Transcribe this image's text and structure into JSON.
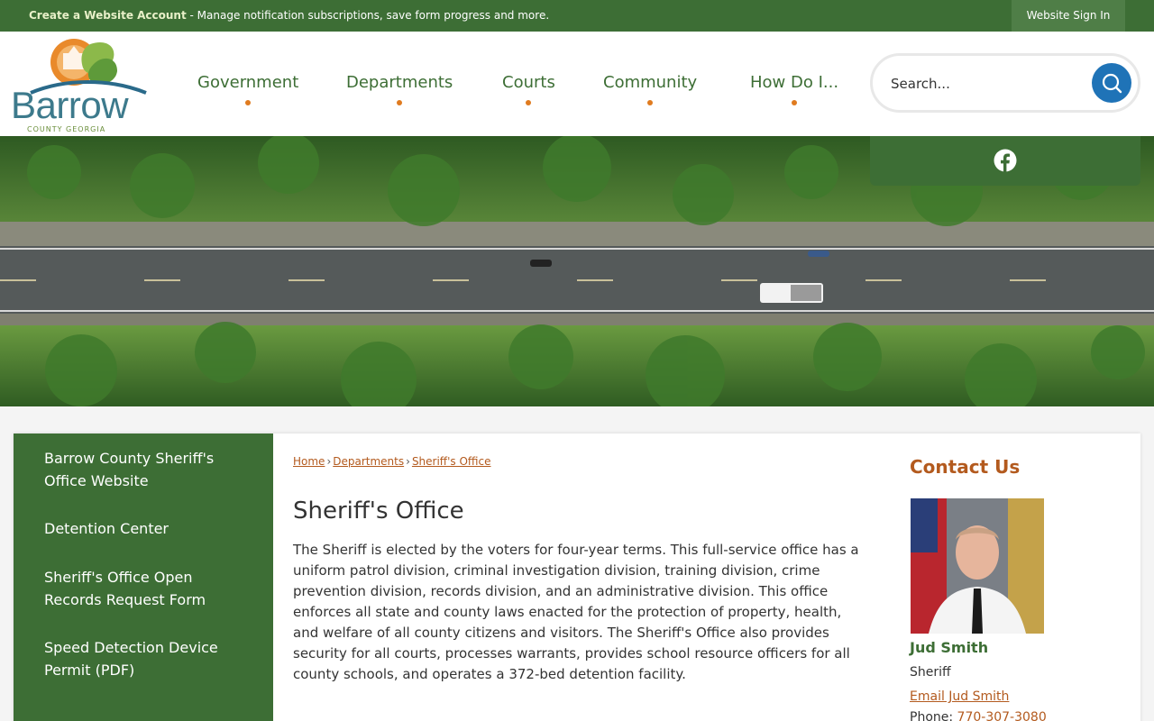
{
  "topbar": {
    "account_link": "Create a Website Account",
    "account_desc": " - Manage notification subscriptions, save form progress and more.",
    "signin": "Website Sign In"
  },
  "logo": {
    "name": "Barrow",
    "subtitle": "COUNTY GEORGIA"
  },
  "nav": {
    "items": [
      {
        "label": "Government"
      },
      {
        "label": "Departments"
      },
      {
        "label": "Courts"
      },
      {
        "label": "Community"
      },
      {
        "label": "How Do I..."
      }
    ]
  },
  "search": {
    "placeholder": "Search..."
  },
  "social": {
    "icon": "facebook-icon"
  },
  "sidebar": {
    "links": [
      {
        "label": "Barrow County Sheriff's Office Website"
      },
      {
        "label": "Detention Center"
      },
      {
        "label": "Sheriff's Office Open Records Request Form"
      },
      {
        "label": "Speed Detection Device Permit (PDF)"
      }
    ]
  },
  "breadcrumb": [
    "Home",
    "Departments",
    "Sheriff's Office"
  ],
  "page": {
    "title": "Sheriff's Office",
    "body": "The Sheriff is elected by the voters for four-year terms. This full-service office has a uniform patrol division, criminal investigation division, training division, crime prevention division, records division, and an administrative division. This office enforces all state and county laws enacted for the protection of property, health, and welfare of all county citizens and visitors. The Sheriff's Office also provides security for all courts, processes warrants, provides school resource officers for all county schools, and operates a 372-bed detention facility."
  },
  "contact": {
    "heading": "Contact Us",
    "name": "Jud Smith",
    "role": "Sheriff",
    "email_label": "Email Jud Smith",
    "phone_label": "Phone: ",
    "phone": "770-307-3080"
  },
  "colors": {
    "brand_green": "#3d6e35",
    "accent_orange": "#e07b1f",
    "link_rust": "#b35a1e",
    "search_blue": "#1f73b7"
  }
}
